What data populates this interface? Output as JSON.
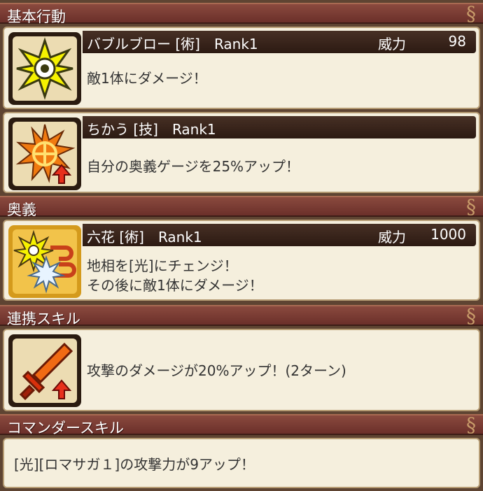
{
  "sections": {
    "basic": {
      "title": "基本行動"
    },
    "ougi": {
      "title": "奥義"
    },
    "renkei": {
      "title": "連携スキル"
    },
    "commander": {
      "title": "コマンダースキル"
    }
  },
  "skills": [
    {
      "name": "バブルブロー [術]　Rank1",
      "power_label": "威力",
      "power": "98",
      "desc": "敵1体にダメージ！",
      "icon": "light-burst-icon"
    },
    {
      "name": "ちかう [技]　Rank1",
      "desc": "自分の奥義ゲージを25%アップ！",
      "icon": "gauge-up-icon"
    },
    {
      "name": "六花 [術]　Rank1",
      "power_label": "威力",
      "power": "1000",
      "desc": "地相を[光]にチェンジ！\nその後に敵1体にダメージ！",
      "icon": "light-change-icon"
    },
    {
      "name": "",
      "desc": "攻撃のダメージが20%アップ！(2ターン)",
      "icon": "sword-up-icon"
    }
  ],
  "commander": {
    "desc": "[光][ロマサガ１]の攻撃力が9アップ！"
  },
  "colors": {
    "header": "#7a3b33",
    "card": "#f5efdd",
    "namebar": "#3a251b"
  }
}
